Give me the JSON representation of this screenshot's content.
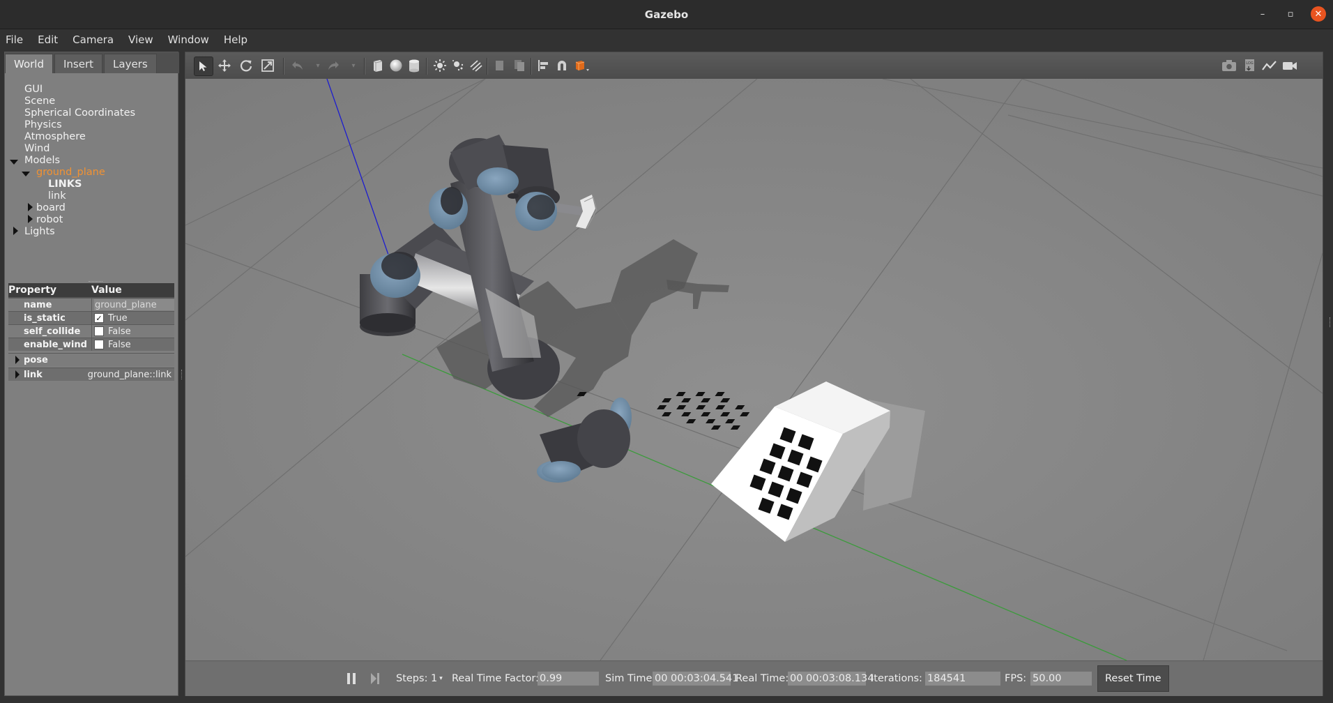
{
  "window": {
    "title": "Gazebo",
    "controls": {
      "minimize": "–",
      "maximize": "▫",
      "close": "✕"
    }
  },
  "menu": [
    "File",
    "Edit",
    "Camera",
    "View",
    "Window",
    "Help"
  ],
  "left_panel": {
    "tabs": [
      "World",
      "Insert",
      "Layers"
    ],
    "active_tab": "World",
    "tree": {
      "gui": "GUI",
      "scene": "Scene",
      "spherical": "Spherical Coordinates",
      "physics": "Physics",
      "atmosphere": "Atmosphere",
      "wind": "Wind",
      "models": "Models",
      "ground_plane": "ground_plane",
      "links_header": "LINKS",
      "link": "link",
      "board": "board",
      "robot": "robot",
      "lights": "Lights"
    },
    "properties": {
      "header": {
        "property": "Property",
        "value": "Value"
      },
      "name": {
        "label": "name",
        "value": "ground_plane"
      },
      "is_static": {
        "label": "is_static",
        "value": "True",
        "checked": true
      },
      "self_collide": {
        "label": "self_collide",
        "value": "False",
        "checked": false
      },
      "enable_wind": {
        "label": "enable_wind",
        "value": "False",
        "checked": false
      },
      "pose": {
        "label": "pose"
      },
      "link": {
        "label": "link",
        "value": "ground_plane::link"
      }
    }
  },
  "toolbar": {
    "icons": [
      "select-mode-icon",
      "translate-mode-icon",
      "rotate-mode-icon",
      "scale-mode-icon",
      "undo-icon",
      "undo-history-icon",
      "redo-icon",
      "redo-history-icon",
      "box-shape-icon",
      "sphere-shape-icon",
      "cylinder-shape-icon",
      "point-light-icon",
      "spot-light-icon",
      "directional-light-icon",
      "copy-icon",
      "paste-icon",
      "align-icon",
      "snap-icon",
      "change-view-icon",
      "screenshot-icon",
      "log-icon",
      "plot-icon",
      "video-record-icon"
    ],
    "log_label": "LOG"
  },
  "bottom_bar": {
    "steps_label": "Steps:",
    "steps_value": "1",
    "rtf_label": "Real Time Factor:",
    "rtf_value": "0.99",
    "sim_time_label": "Sim Time:",
    "sim_time_value": "00 00:03:04.541",
    "real_time_label": "Real Time:",
    "real_time_value": "00 00:03:08.134",
    "iterations_label": "Iterations:",
    "iterations_value": "184541",
    "fps_label": "FPS:",
    "fps_value": "50.00",
    "reset_label": "Reset Time"
  },
  "colors": {
    "selected_tree_item": "#f29232",
    "close_button": "#e95420",
    "x_axis": "#3b9b3b",
    "z_axis": "#1c1cd0",
    "joint_cap": "#7a97b0"
  }
}
